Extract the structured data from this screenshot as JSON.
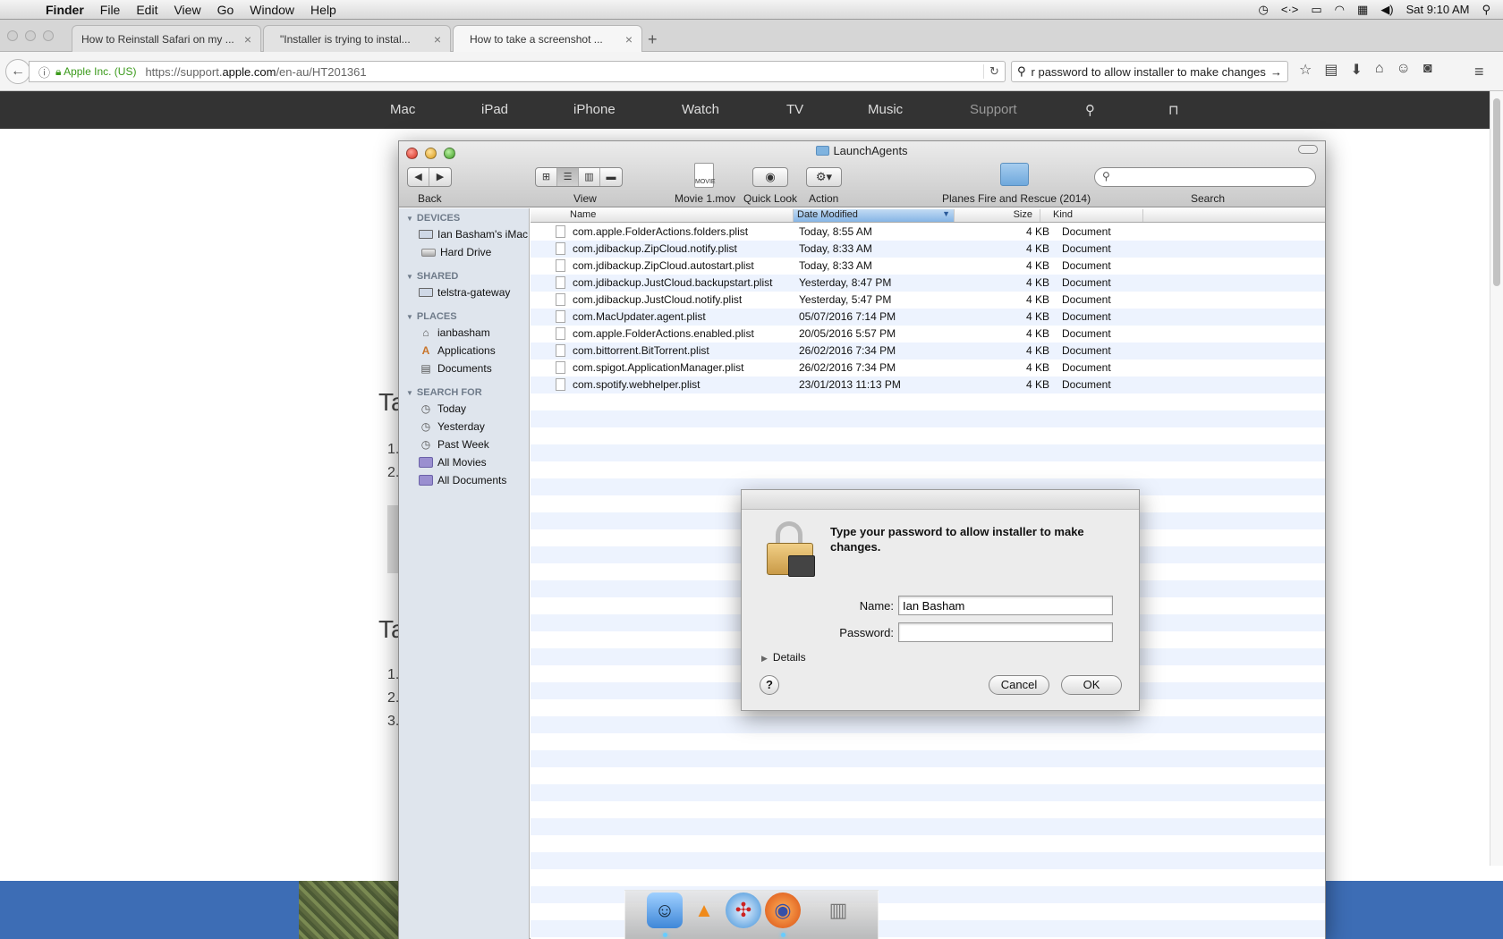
{
  "menubar": {
    "apple_glyph": "",
    "app_name": "Finder",
    "menus": [
      "File",
      "Edit",
      "View",
      "Go",
      "Window",
      "Help"
    ],
    "clock": "Sat 9:10 AM",
    "status_glyphs": {
      "timemachine": "◷",
      "code": "<·>",
      "display": "▭",
      "wifi": "◠",
      "input": "▦",
      "volume": "◀)",
      "spotlight": "⚲"
    }
  },
  "browser": {
    "tabs": [
      {
        "label": "How to Reinstall Safari on my ...",
        "favicon": ""
      },
      {
        "label": "\"Installer is trying to instal...",
        "favicon": ""
      },
      {
        "label": "How to take a screenshot ...",
        "favicon": ""
      }
    ],
    "tab_close": "×",
    "new_tab": "+",
    "back": "←",
    "site_identity": "Apple Inc. (US)",
    "url_prefix": "https://support.",
    "url_domain": "apple.com",
    "url_path": "/en-au/HT201361",
    "reload": "↻",
    "search_text": "r password to allow installer to make changes",
    "search_go": "→",
    "toolbar_glyphs": {
      "bookmark": "☆",
      "library": "▤",
      "download": "⬇",
      "home": "⌂",
      "chat": "☺",
      "pocket": "◙",
      "menu": "≡"
    }
  },
  "site_nav": {
    "logo": "",
    "items": [
      "Mac",
      "iPad",
      "iPhone",
      "Watch",
      "TV",
      "Music",
      "Support"
    ],
    "search": "⚲",
    "bag": "⊓"
  },
  "page_fragments": {
    "heading_a": "Ta",
    "list_a": [
      "1.",
      "2."
    ],
    "heading_b": "Ta",
    "list_b": [
      "1.",
      "2.",
      "3."
    ]
  },
  "finder": {
    "title": "LaunchAgents",
    "toolbar": {
      "back_label": "Back",
      "back_prev": "◀",
      "back_next": "▶",
      "view_label": "View",
      "view_modes": [
        "⊞",
        "☰",
        "▥",
        "▬"
      ],
      "movie_label": "Movie 1.mov",
      "movie_badge": "MOVIE",
      "quicklook_label": "Quick Look",
      "quicklook_glyph": "◉",
      "action_label": "Action",
      "action_glyph": "⚙▾",
      "folder_label": "Planes Fire and Rescue (2014)",
      "search_label": "Search",
      "search_glyph": "⚲"
    },
    "sidebar": {
      "collapse_glyph": "▼",
      "devices_header": "DEVICES",
      "devices": [
        "Ian Basham's iMac",
        "Hard Drive"
      ],
      "shared_header": "SHARED",
      "shared": [
        "telstra-gateway"
      ],
      "places_header": "PLACES",
      "places": [
        {
          "label": "ianbasham",
          "glyph": "⌂"
        },
        {
          "label": "Applications",
          "glyph": "A"
        },
        {
          "label": "Documents",
          "glyph": "▤"
        }
      ],
      "search_header": "SEARCH FOR",
      "search_items": [
        {
          "label": "Today",
          "glyph": "◷"
        },
        {
          "label": "Yesterday",
          "glyph": "◷"
        },
        {
          "label": "Past Week",
          "glyph": "◷"
        },
        {
          "label": "All Movies",
          "glyph": ""
        },
        {
          "label": "All Documents",
          "glyph": ""
        }
      ]
    },
    "columns": {
      "name": "Name",
      "date": "Date Modified",
      "size": "Size",
      "kind": "Kind",
      "sort_glyph": "▼"
    },
    "files": [
      {
        "name": "com.apple.FolderActions.folders.plist",
        "date": "Today, 8:55 AM",
        "size": "4 KB",
        "kind": "Document"
      },
      {
        "name": "com.jdibackup.ZipCloud.notify.plist",
        "date": "Today, 8:33 AM",
        "size": "4 KB",
        "kind": "Document"
      },
      {
        "name": "com.jdibackup.ZipCloud.autostart.plist",
        "date": "Today, 8:33 AM",
        "size": "4 KB",
        "kind": "Document"
      },
      {
        "name": "com.jdibackup.JustCloud.backupstart.plist",
        "date": "Yesterday, 8:47 PM",
        "size": "4 KB",
        "kind": "Document"
      },
      {
        "name": "com.jdibackup.JustCloud.notify.plist",
        "date": "Yesterday, 5:47 PM",
        "size": "4 KB",
        "kind": "Document"
      },
      {
        "name": "com.MacUpdater.agent.plist",
        "date": "05/07/2016 7:14 PM",
        "size": "4 KB",
        "kind": "Document"
      },
      {
        "name": "com.apple.FolderActions.enabled.plist",
        "date": "20/05/2016 5:57 PM",
        "size": "4 KB",
        "kind": "Document"
      },
      {
        "name": "com.bittorrent.BitTorrent.plist",
        "date": "26/02/2016 7:34 PM",
        "size": "4 KB",
        "kind": "Document"
      },
      {
        "name": "com.spigot.ApplicationManager.plist",
        "date": "26/02/2016 7:34 PM",
        "size": "4 KB",
        "kind": "Document"
      },
      {
        "name": "com.spotify.webhelper.plist",
        "date": "23/01/2013 11:13 PM",
        "size": "4 KB",
        "kind": "Document"
      }
    ]
  },
  "auth_dialog": {
    "message": "Type your password to allow installer to make changes.",
    "name_label": "Name:",
    "name_value": "Ian Basham",
    "password_label": "Password:",
    "password_value": "",
    "details_glyph": "▶",
    "details_label": "Details",
    "help_label": "?",
    "cancel_label": "Cancel",
    "ok_label": "OK"
  },
  "dock": {
    "apps": [
      {
        "name": "finder",
        "glyph": "☺",
        "color": "#5aa0e6"
      },
      {
        "name": "vlc",
        "glyph": "▲",
        "color": "#f08a1a"
      },
      {
        "name": "safari",
        "glyph": "✣",
        "color": "#3b8fd8"
      },
      {
        "name": "firefox",
        "glyph": "◉",
        "color": "#e8661e"
      },
      {
        "name": "trash",
        "glyph": "▥",
        "color": "#9a9a9a"
      }
    ]
  },
  "colors": {
    "menubar": "#e6e6e6",
    "site_nav": "#333333",
    "secure_green": "#3a9a1a",
    "sort_blue": "#86b5e6",
    "footer_blue": "#3d6db5"
  }
}
